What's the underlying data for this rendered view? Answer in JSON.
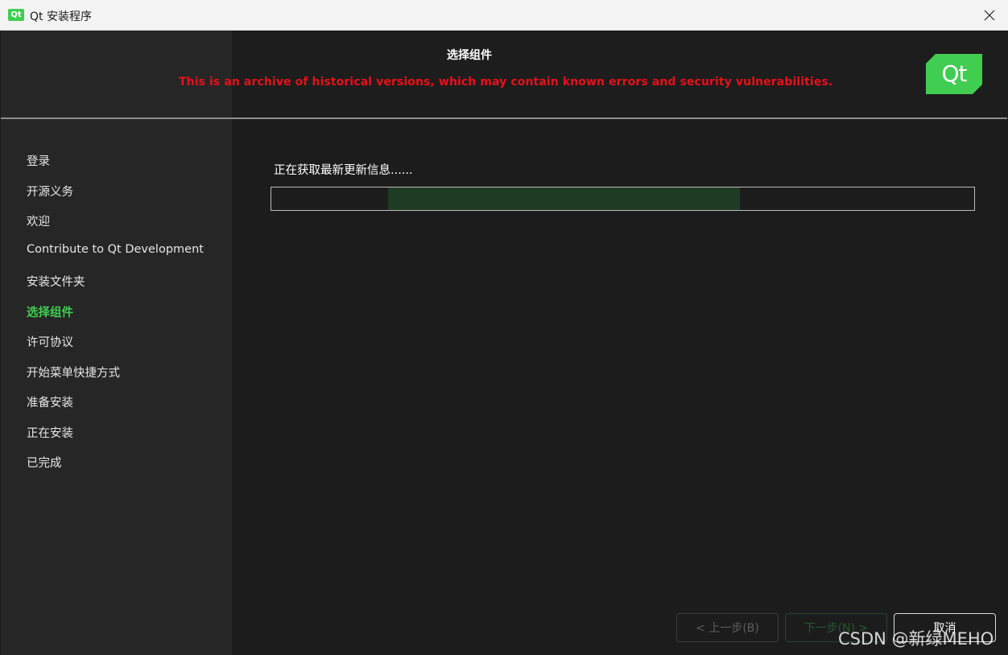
{
  "window": {
    "icon_text": "Qt",
    "title": "Qt 安装程序"
  },
  "header": {
    "page_title": "选择组件",
    "warning": "This is an archive of historical versions, which may contain known errors and security vulnerabilities.",
    "logo_text": "Qt"
  },
  "sidebar": {
    "items": [
      {
        "label": "登录"
      },
      {
        "label": "开源义务"
      },
      {
        "label": "欢迎"
      },
      {
        "label": "Contribute to Qt Development"
      },
      {
        "label": "安装文件夹"
      },
      {
        "label": "选择组件",
        "active": true
      },
      {
        "label": "许可协议"
      },
      {
        "label": "开始菜单快捷方式"
      },
      {
        "label": "准备安装"
      },
      {
        "label": "正在安装"
      },
      {
        "label": "已完成"
      }
    ]
  },
  "content": {
    "status": "正在获取最新更新信息......",
    "progress": "indeterminate"
  },
  "buttons": {
    "back": "< 上一步(B)",
    "next": "下一步(N) >",
    "cancel": "取消"
  },
  "watermark": "CSDN @新绿MEHO",
  "colors": {
    "accent": "#41cd52",
    "warning": "#e8101a",
    "background": "#1c1c1c",
    "sidebar": "#262626"
  }
}
